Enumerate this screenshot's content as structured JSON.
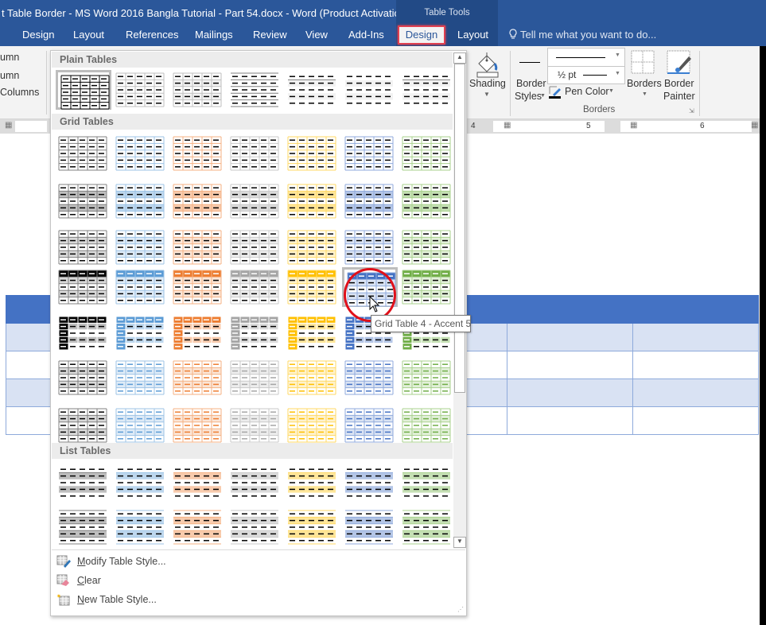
{
  "window": {
    "title": "t Table Border - MS Word 2016 Bangla Tutorial - Part 54.docx - Word (Product Activation..."
  },
  "tabs": [
    {
      "label": "Design"
    },
    {
      "label": "Layout"
    },
    {
      "label": "References"
    },
    {
      "label": "Mailings"
    },
    {
      "label": "Review"
    },
    {
      "label": "View"
    },
    {
      "label": "Add-Ins"
    }
  ],
  "context_tabs": {
    "group_label": "Table Tools",
    "design": "Design",
    "layout": "Layout"
  },
  "tellme": {
    "placeholder": "Tell me what you want to do..."
  },
  "ribbon_left": {
    "items": [
      "umn",
      "umn",
      "Columns"
    ]
  },
  "ribbon": {
    "shading": "Shading",
    "border_styles": [
      "Border",
      "Styles"
    ],
    "pen_weight": "½ pt",
    "pen_color": "Pen Color",
    "borders": "Borders",
    "border_painter": [
      "Border",
      "Painter"
    ],
    "group_label": "Borders"
  },
  "ruler": {
    "numbers": [
      "4",
      "5",
      "6"
    ]
  },
  "gallery": {
    "sections": [
      {
        "label": "Plain Tables"
      },
      {
        "label": "Grid Tables"
      },
      {
        "label": "List Tables"
      }
    ],
    "accent_colors": {
      "black": "#000000",
      "blue": "#5b9bd5",
      "orange": "#ed7d31",
      "gray": "#a5a5a5",
      "gold": "#ffc000",
      "blue2": "#4472c4",
      "green": "#70ad47"
    },
    "hovered_style": "Grid Table 4 - Accent 5",
    "menu": [
      {
        "label": "Modify Table Style...",
        "icon": "modify-table-style-icon"
      },
      {
        "label": "Clear",
        "icon": "clear-eraser-icon"
      },
      {
        "label": "New Table Style...",
        "icon": "new-table-style-icon"
      }
    ]
  },
  "tooltip": {
    "text": "Grid Table 4 - Accent 5"
  }
}
